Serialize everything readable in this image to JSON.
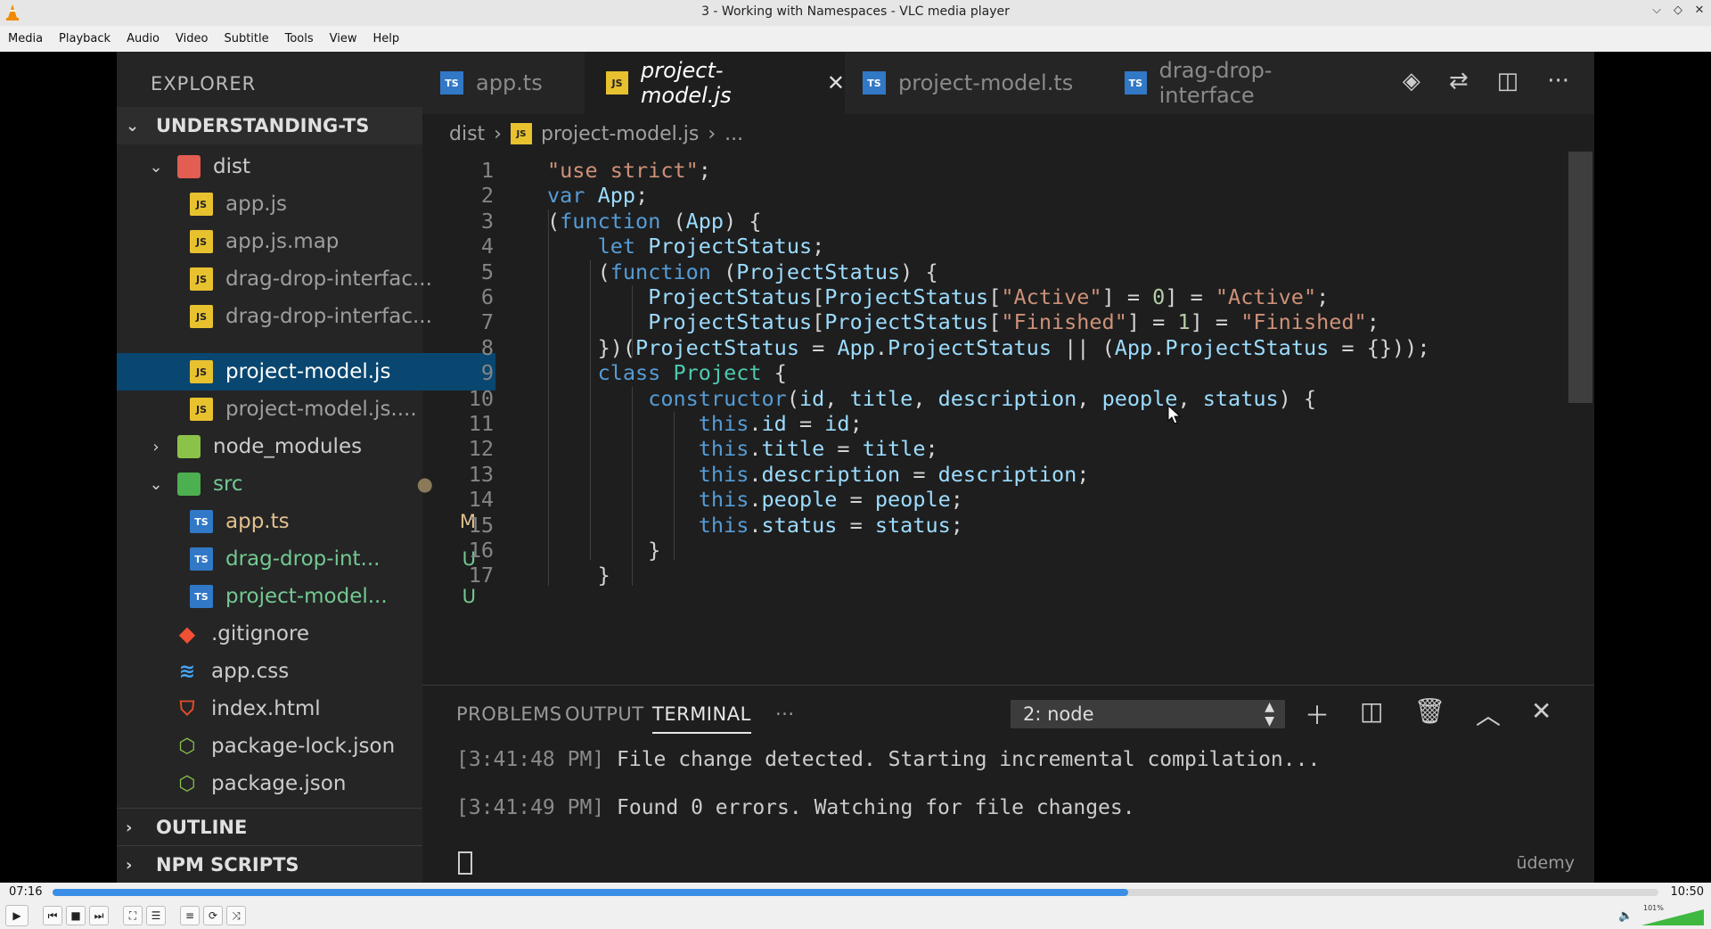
{
  "window": {
    "title": "3 - Working with Namespaces - VLC media player"
  },
  "menu": [
    "Media",
    "Playback",
    "Audio",
    "Video",
    "Subtitle",
    "Tools",
    "View",
    "Help"
  ],
  "editor": {
    "explorer_title": "EXPLORER",
    "project": "UNDERSTANDING-TS",
    "tree": [
      {
        "label": "dist",
        "type": "folder"
      },
      {
        "label": "app.js",
        "type": "js"
      },
      {
        "label": "app.js.map",
        "type": "js"
      },
      {
        "label": "drag-drop-interfac...",
        "type": "js"
      },
      {
        "label": "drag-drop-interfac...",
        "type": "js"
      },
      {
        "label": "project-model.js",
        "type": "js"
      },
      {
        "label": "project-model.js....",
        "type": "js"
      },
      {
        "label": "node_modules",
        "type": "folder"
      },
      {
        "label": "src",
        "type": "folder"
      },
      {
        "label": "app.ts",
        "type": "ts",
        "badge": "M"
      },
      {
        "label": "drag-drop-int...",
        "type": "ts",
        "badge": "U"
      },
      {
        "label": "project-model...",
        "type": "ts",
        "badge": "U"
      },
      {
        "label": ".gitignore",
        "type": "git"
      },
      {
        "label": "app.css",
        "type": "css"
      },
      {
        "label": "index.html",
        "type": "html"
      },
      {
        "label": "package-lock.json",
        "type": "json"
      },
      {
        "label": "package.json",
        "type": "json"
      }
    ],
    "outline": "OUTLINE",
    "npm_scripts": "NPM SCRIPTS",
    "tabs": [
      {
        "label": "app.ts",
        "type": "ts"
      },
      {
        "label": "project-model.js",
        "type": "js",
        "active": true
      },
      {
        "label": "project-model.ts",
        "type": "ts"
      },
      {
        "label": "drag-drop-interface",
        "type": "ts"
      }
    ],
    "breadcrumb": [
      "dist",
      "project-model.js",
      "..."
    ],
    "code_lines": [
      "\"use strict\";",
      "var App;",
      "(function (App) {",
      "    let ProjectStatus;",
      "    (function (ProjectStatus) {",
      "        ProjectStatus[ProjectStatus[\"Active\"] = 0] = \"Active\";",
      "        ProjectStatus[ProjectStatus[\"Finished\"] = 1] = \"Finished\";",
      "    })(ProjectStatus = App.ProjectStatus || (App.ProjectStatus = {}));",
      "    class Project {",
      "        constructor(id, title, description, people, status) {",
      "            this.id = id;",
      "            this.title = title;",
      "            this.description = description;",
      "            this.people = people;",
      "            this.status = status;",
      "        }",
      "    }"
    ],
    "panel_tabs": [
      "PROBLEMS",
      "OUTPUT",
      "TERMINAL",
      "···"
    ],
    "terminal_select": "2: node",
    "terminal_lines": [
      {
        "time": "[3:41:48 PM]",
        "text": " File change detected. Starting incremental compilation..."
      },
      {
        "time": "[3:41:49 PM]",
        "text": " Found 0 errors. Watching for file changes."
      }
    ],
    "watermark": "ūdemy"
  },
  "player": {
    "elapsed": "07:16",
    "total": "10:50",
    "progress_fraction": 0.67,
    "volume_label": "101%",
    "accent_color": "#3a8ee6"
  }
}
